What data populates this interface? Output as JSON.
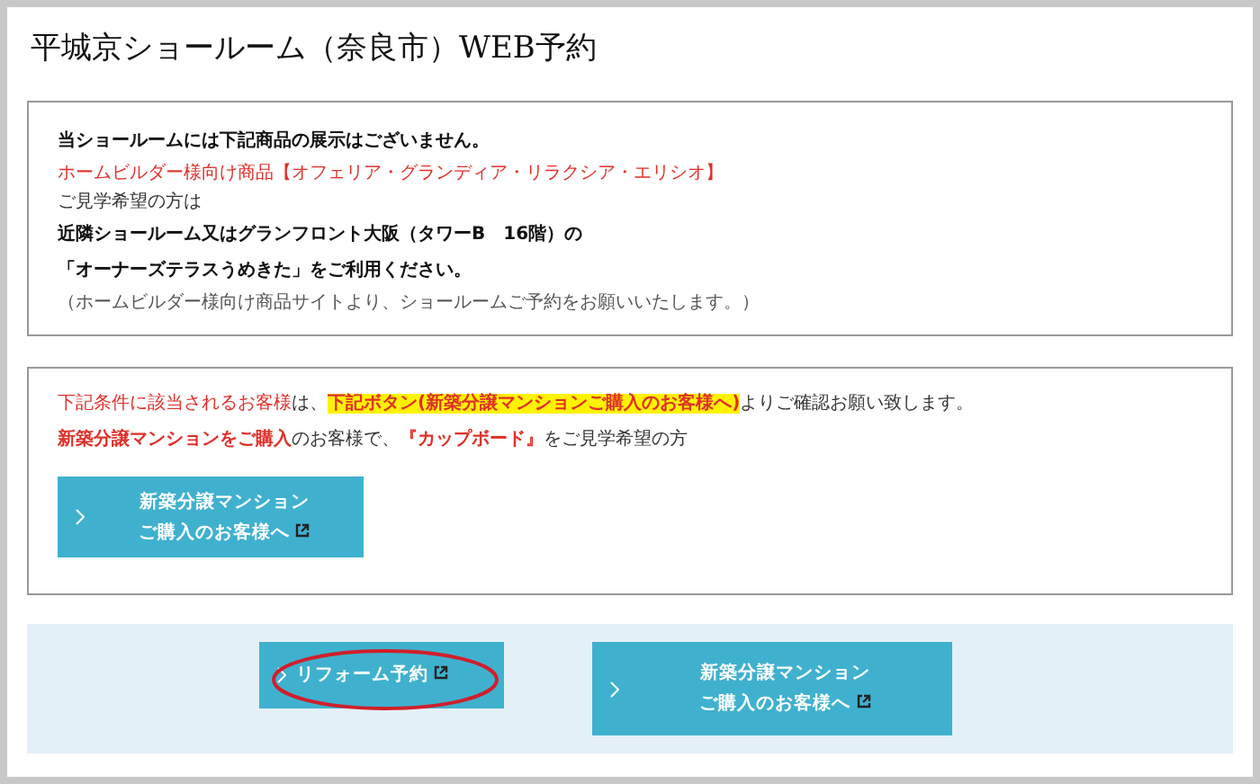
{
  "title": "平城京ショールーム（奈良市）WEB予約",
  "notice": {
    "lines": [
      {
        "kind": "bold",
        "text": "当ショールームには下記商品の展示はございません。"
      },
      {
        "kind": "red",
        "text": "ホームビルダー様向け商品【オフェリア・グランディア・リラクシア・エリシオ】"
      },
      {
        "kind": "plain",
        "text": "ご見学希望の方は"
      },
      {
        "kind": "bold",
        "text": "近隣ショールーム又はグランフロント大阪（タワーB　16階）の"
      },
      {
        "kind": "bold",
        "text": "「オーナーズテラスうめきた」をご利用ください。"
      },
      {
        "kind": "muted",
        "text": "（ホームビルダー様向け商品サイトより、ショールームご予約をお願いいたします。）"
      }
    ]
  },
  "condition": {
    "sentences": [
      [
        {
          "kind": "red",
          "text": "下記条件に該当されるお客様"
        },
        {
          "kind": "plain",
          "text": "は、"
        },
        {
          "kind": "highlight",
          "text": "下記ボタン(新築分譲マンションご購入のお客様へ)"
        },
        {
          "kind": "plain",
          "text": "よりご確認お願い致します。"
        }
      ],
      [
        {
          "kind": "red-bold",
          "text": "新築分譲マンションをご購入"
        },
        {
          "kind": "plain",
          "text": "のお客様で、"
        },
        {
          "kind": "red-bold",
          "text": "『カップボード』"
        },
        {
          "kind": "plain",
          "text": "をご見学希望の方"
        }
      ]
    ],
    "button": {
      "lines": [
        "新築分譲マンション",
        "ご購入のお客様へ"
      ],
      "circled": false
    }
  },
  "actions": [
    {
      "lines": [
        "リフォーム予約"
      ],
      "circled": true
    },
    {
      "lines": [
        "新築分譲マンション",
        "ご購入のお客様へ"
      ],
      "circled": false
    }
  ]
}
